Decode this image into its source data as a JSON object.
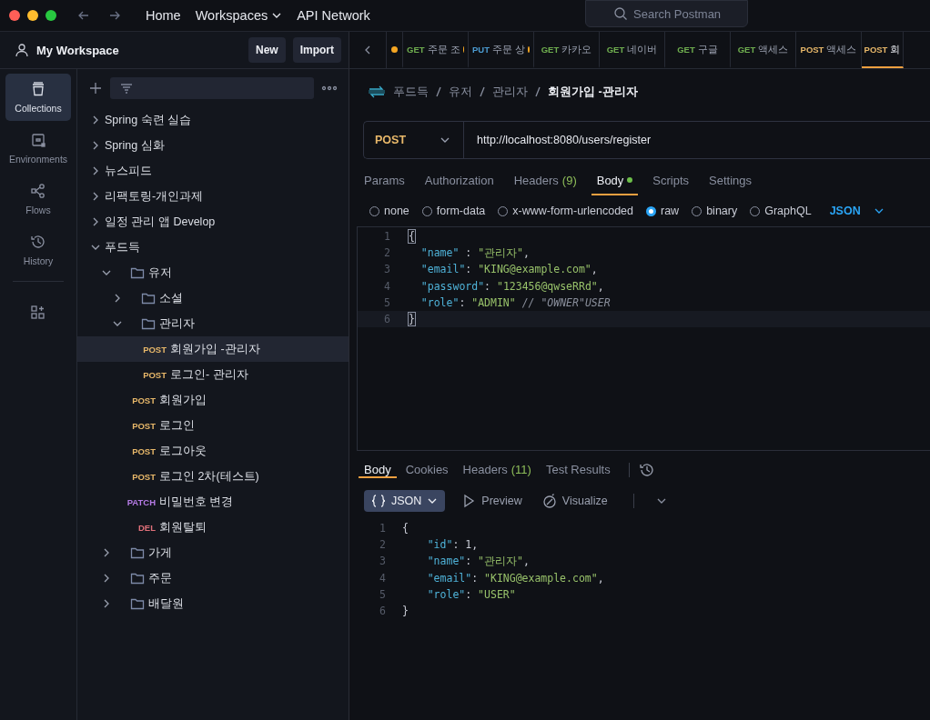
{
  "titlebar": {
    "nav": [
      {
        "label": "Home",
        "dropdown": false
      },
      {
        "label": "Workspaces",
        "dropdown": true
      },
      {
        "label": "API Network",
        "dropdown": false
      }
    ],
    "search": {
      "placeholder": "Search Postman"
    }
  },
  "workspace": {
    "name": "My Workspace",
    "buttons": [
      "New",
      "Import"
    ]
  },
  "rail": [
    {
      "kind": "collections",
      "label": "Collections",
      "selected": true
    },
    {
      "kind": "environments",
      "label": "Environments",
      "selected": false
    },
    {
      "kind": "flows",
      "label": "Flows",
      "selected": false
    },
    {
      "kind": "history",
      "label": "History",
      "selected": false
    },
    {
      "kind": "configure",
      "selected": false
    }
  ],
  "tree": [
    {
      "kind": "collection",
      "label": "Spring 숙련 실습",
      "expanded": false
    },
    {
      "kind": "collection",
      "label": "Spring 심화",
      "expanded": false
    },
    {
      "kind": "collection",
      "label": "뉴스피드",
      "expanded": false
    },
    {
      "kind": "collection",
      "label": "리팩토링-개인과제",
      "expanded": false
    },
    {
      "kind": "collection",
      "label": "일정 관리 앱 Develop",
      "expanded": false
    },
    {
      "kind": "collection",
      "label": "푸드득",
      "expanded": true,
      "children": [
        {
          "kind": "folder",
          "label": "유저",
          "expanded": true,
          "children": [
            {
              "kind": "folder",
              "label": "소셜",
              "expanded": false
            },
            {
              "kind": "folder",
              "label": "관리자",
              "expanded": true,
              "children": [
                {
                  "kind": "request",
                  "method": "POST",
                  "label": "회원가입 -관리자",
                  "selected": true
                },
                {
                  "kind": "request",
                  "method": "POST",
                  "label": "로그인- 관리자",
                  "selected": false
                }
              ]
            },
            {
              "kind": "request",
              "method": "POST",
              "label": "회원가입",
              "selected": false
            },
            {
              "kind": "request",
              "method": "POST",
              "label": "로그인",
              "selected": false
            },
            {
              "kind": "request",
              "method": "POST",
              "label": "로그아웃",
              "selected": false
            },
            {
              "kind": "request",
              "method": "POST",
              "label": "로그인 2차(테스트)",
              "selected": false
            },
            {
              "kind": "request",
              "method": "PATCH",
              "label": "비밀번호 변경",
              "selected": false
            },
            {
              "kind": "request",
              "method": "DEL",
              "label": "회원탈퇴",
              "selected": false
            }
          ]
        },
        {
          "kind": "folder",
          "label": "가게",
          "expanded": false
        },
        {
          "kind": "folder",
          "label": "주문",
          "expanded": false
        },
        {
          "kind": "folder",
          "label": "배달원",
          "expanded": false
        }
      ]
    }
  ],
  "tabs": [
    {
      "unsaved": true,
      "selected": false
    },
    {
      "method": "GET",
      "label": "주문 조",
      "unsaved": true,
      "selected": false
    },
    {
      "method": "PUT",
      "label": "주문 상",
      "unsaved": true,
      "selected": false
    },
    {
      "method": "GET",
      "label": "카카오",
      "unsaved": false,
      "selected": false
    },
    {
      "method": "GET",
      "label": "네이버",
      "unsaved": false,
      "selected": false
    },
    {
      "method": "GET",
      "label": "구글",
      "unsaved": false,
      "selected": false
    },
    {
      "method": "GET",
      "label": "액세스",
      "unsaved": false,
      "selected": false
    },
    {
      "method": "POST",
      "label": "액세스",
      "unsaved": false,
      "selected": false
    },
    {
      "method": "POST",
      "label": "회",
      "unsaved": false,
      "selected": true
    }
  ],
  "breadcrumb": [
    "푸드득",
    "유저",
    "관리자",
    "회원가입 -관리자"
  ],
  "request": {
    "method": "POST",
    "url": "http://localhost:8080/users/register"
  },
  "request_tabs": [
    {
      "label": "Params",
      "dot": false,
      "selected": false
    },
    {
      "label": "Authorization",
      "dot": false,
      "selected": false
    },
    {
      "label": "Headers",
      "count": "(9)",
      "dot": false,
      "selected": false
    },
    {
      "label": "Body",
      "dot": true,
      "selected": true
    },
    {
      "label": "Scripts",
      "dot": false,
      "selected": false
    },
    {
      "label": "Settings",
      "dot": false,
      "selected": false
    }
  ],
  "body_types": [
    {
      "label": "none",
      "selected": false
    },
    {
      "label": "form-data",
      "selected": false
    },
    {
      "label": "x-www-form-urlencoded",
      "selected": false
    },
    {
      "label": "raw",
      "selected": true
    },
    {
      "label": "binary",
      "selected": false
    },
    {
      "label": "GraphQL",
      "selected": false
    }
  ],
  "body_format": "JSON",
  "request_body": [
    {
      "number": "1",
      "current": false,
      "tokens": [
        {
          "kind": "match",
          "text": "{"
        }
      ]
    },
    {
      "number": "2",
      "current": false,
      "tokens": [
        {
          "kind": "key",
          "text": "  \"name\""
        },
        {
          "kind": "punct",
          "text": " : "
        },
        {
          "kind": "string",
          "text": "\"관리자\""
        },
        {
          "kind": "punct",
          "text": ","
        }
      ]
    },
    {
      "number": "3",
      "current": false,
      "tokens": [
        {
          "kind": "key",
          "text": "  \"email\""
        },
        {
          "kind": "punct",
          "text": ": "
        },
        {
          "kind": "string",
          "text": "\"KING@example.com\""
        },
        {
          "kind": "punct",
          "text": ","
        }
      ]
    },
    {
      "number": "4",
      "current": false,
      "tokens": [
        {
          "kind": "key",
          "text": "  \"password\""
        },
        {
          "kind": "punct",
          "text": ": "
        },
        {
          "kind": "string",
          "text": "\"123456@qwseRRd\""
        },
        {
          "kind": "punct",
          "text": ","
        }
      ]
    },
    {
      "number": "5",
      "current": false,
      "tokens": [
        {
          "kind": "key",
          "text": "  \"role\""
        },
        {
          "kind": "punct",
          "text": ": "
        },
        {
          "kind": "string",
          "text": "\"ADMIN\""
        },
        {
          "kind": "comment",
          "text": " // \"OWNER\"USER"
        }
      ]
    },
    {
      "number": "6",
      "current": true,
      "tokens": [
        {
          "kind": "match",
          "text": "}"
        }
      ]
    }
  ],
  "response_tabs": [
    {
      "label": "Body",
      "selected": true
    },
    {
      "label": "Cookies",
      "selected": false
    },
    {
      "label": "Headers",
      "count": "(11)",
      "selected": false
    },
    {
      "label": "Test Results",
      "selected": false
    }
  ],
  "response_view": {
    "format": "JSON",
    "actions": [
      "Preview",
      "Visualize"
    ]
  },
  "response_body": [
    {
      "number": "1",
      "tokens": [
        {
          "kind": "punct",
          "text": "{"
        }
      ]
    },
    {
      "number": "2",
      "tokens": [
        {
          "kind": "key",
          "text": "    \"id\""
        },
        {
          "kind": "punct",
          "text": ": 1,"
        }
      ]
    },
    {
      "number": "3",
      "tokens": [
        {
          "kind": "key",
          "text": "    \"name\""
        },
        {
          "kind": "punct",
          "text": ": "
        },
        {
          "kind": "string",
          "text": "\"관리자\""
        },
        {
          "kind": "punct",
          "text": ","
        }
      ]
    },
    {
      "number": "4",
      "tokens": [
        {
          "kind": "key",
          "text": "    \"email\""
        },
        {
          "kind": "punct",
          "text": ": "
        },
        {
          "kind": "string",
          "text": "\"KING@example.com\""
        },
        {
          "kind": "punct",
          "text": ","
        }
      ]
    },
    {
      "number": "5",
      "tokens": [
        {
          "kind": "key",
          "text": "    \"role\""
        },
        {
          "kind": "punct",
          "text": ": "
        },
        {
          "kind": "string",
          "text": "\"USER\""
        }
      ]
    },
    {
      "number": "6",
      "tokens": [
        {
          "kind": "punct",
          "text": "}"
        }
      ]
    }
  ]
}
